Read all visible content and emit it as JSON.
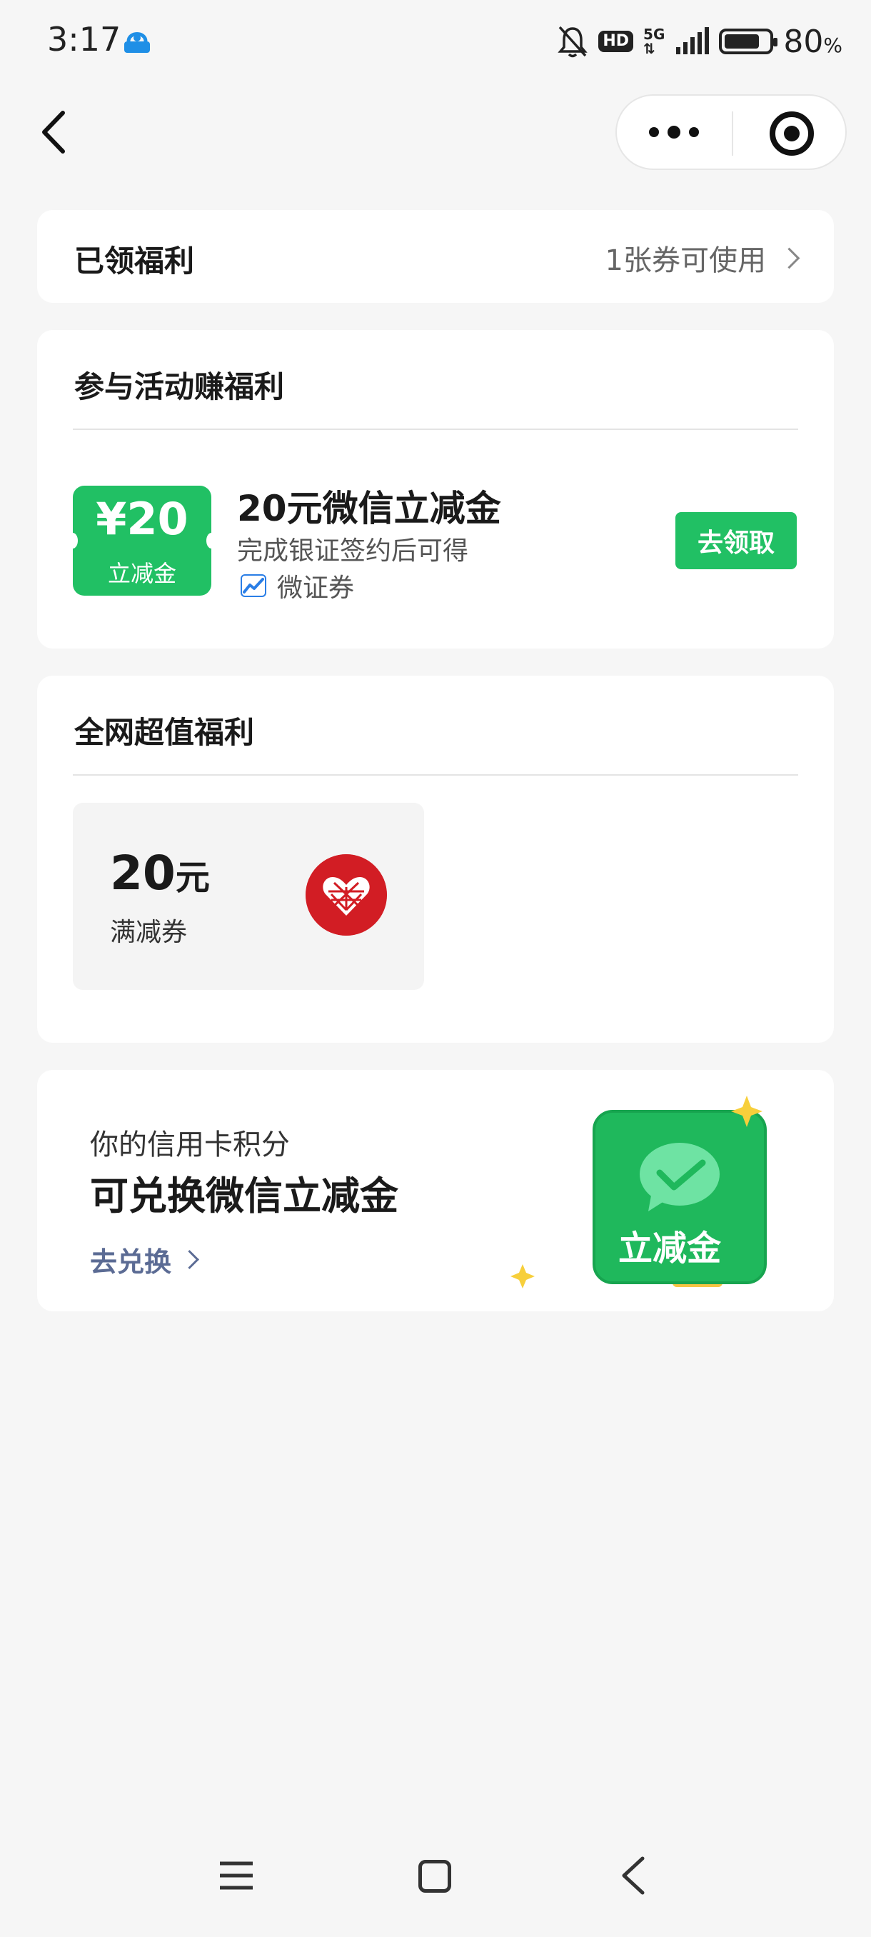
{
  "status_bar": {
    "time": "3:17",
    "network": "5G",
    "hd_label": "HD",
    "battery_level": 0.8,
    "battery_value": "80",
    "battery_unit": "%",
    "icons": [
      "alipay-app-icon",
      "bell-muted-icon",
      "hd-icon",
      "signal-icon",
      "battery-icon"
    ]
  },
  "nav": {
    "icons": [
      "back-icon",
      "more-icon",
      "close-miniprogram-icon"
    ]
  },
  "claimed": {
    "title": "已领福利",
    "summary": "1张券可使用"
  },
  "activity": {
    "title": "参与活动赚福利",
    "coupon": {
      "badge_amount": "¥20",
      "badge_label": "立减金",
      "title": "20元微信立减金",
      "desc": "完成银证签约后可得",
      "source": "微证券",
      "action": "去领取"
    }
  },
  "deals": {
    "title": "全网超值福利",
    "items": [
      {
        "amount": "20",
        "unit": "元",
        "label": "满减券",
        "logo": "pinduoduo-logo"
      }
    ]
  },
  "promo": {
    "subtitle": "你的信用卡积分",
    "title": "可兑换微信立减金",
    "link": "去兑换",
    "art_label": "立减金"
  },
  "colors": {
    "brand_green": "#21c064",
    "link_blue": "#5b6b94",
    "page_bg": "#f6f6f6"
  },
  "bottom_nav": {
    "icons": [
      "menu-icon",
      "home-icon",
      "back-icon"
    ]
  }
}
